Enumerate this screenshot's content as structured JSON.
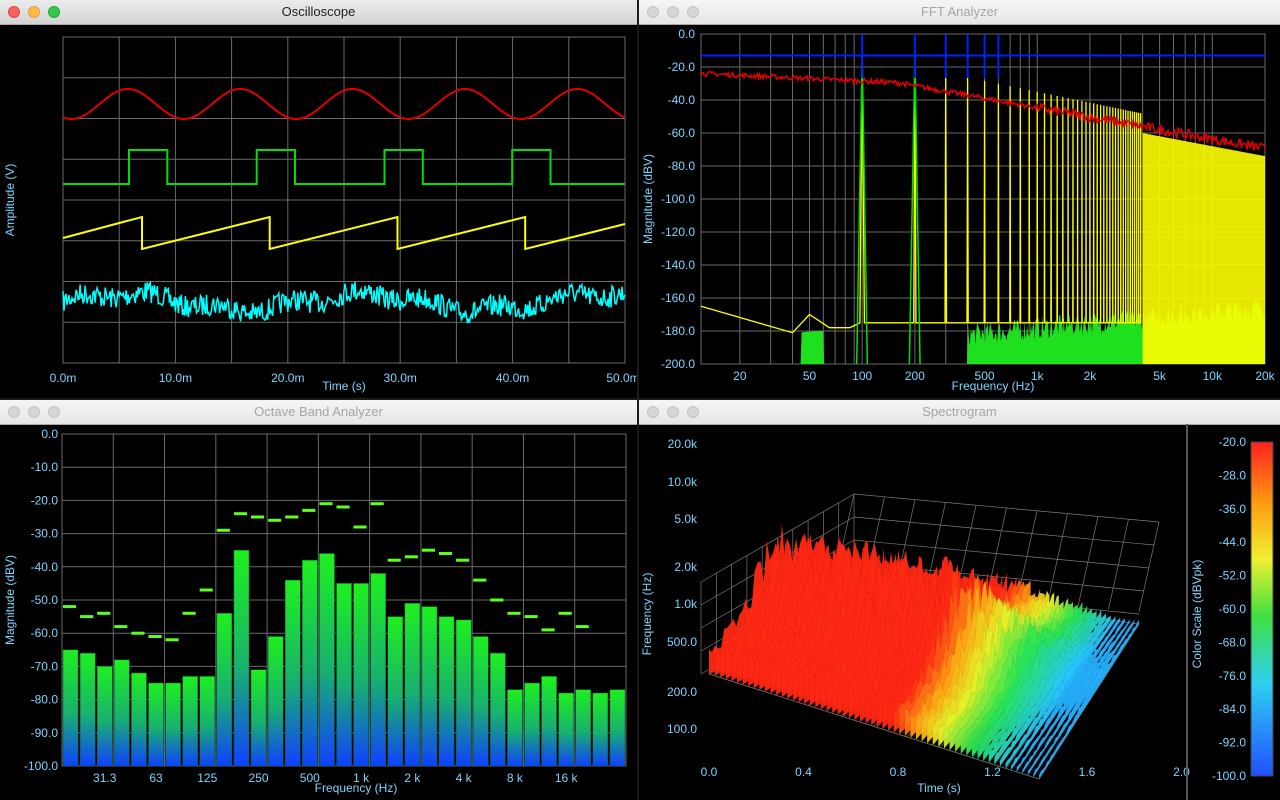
{
  "windows": {
    "oscilloscope": {
      "title": "Oscilloscope"
    },
    "fft": {
      "title": "FFT Analyzer"
    },
    "octave": {
      "title": "Octave Band Analyzer"
    },
    "spectrogram": {
      "title": "Spectrogram"
    }
  },
  "colors": {
    "sine": "#e00000",
    "square": "#00e000",
    "saw": "#ffff00",
    "noise": "#00ffff",
    "axis_text": "#7fd4ff",
    "grid": "#6a6a6a",
    "max_line": "#0020ff"
  },
  "chart_data": [
    {
      "type": "line",
      "xlabel": "Time (s)",
      "ylabel": "Amplitude (V)",
      "x_ticks": [
        "0.0m",
        "10.0m",
        "20.0m",
        "30.0m",
        "40.0m",
        "50.0m"
      ],
      "xlim": [
        0,
        50
      ],
      "series": [
        {
          "kind": "sine",
          "periods": 5
        },
        {
          "kind": "square",
          "periods": 4.4
        },
        {
          "kind": "sawtooth",
          "periods": 4.4
        },
        {
          "kind": "noise"
        }
      ],
      "grid": true
    },
    {
      "type": "line",
      "xlabel": "Frequency (Hz)",
      "ylabel": "Magnitude (dBV)",
      "y_ticks": [
        "0.0",
        "-20.0",
        "-40.0",
        "-60.0",
        "-80.0",
        "-100.0",
        "-120.0",
        "-140.0",
        "-160.0",
        "-180.0",
        "-200.0"
      ],
      "x_ticks": [
        "20",
        "50",
        "100",
        "200",
        "500",
        "1k",
        "2k",
        "5k",
        "10k",
        "20k"
      ],
      "ylim": [
        -200,
        0
      ],
      "xlim": [
        12,
        20000
      ],
      "log_x": true,
      "peak_hold_level": -13,
      "harmonics_hz": [
        100,
        200,
        300,
        400,
        500,
        600
      ],
      "grid": true
    },
    {
      "type": "bar",
      "xlabel": "Frequency (Hz)",
      "ylabel": "Magnitude (dBV)",
      "x_ticks": [
        "31.3",
        "63",
        "125",
        "250",
        "500",
        "1 k",
        "2 k",
        "4 k",
        "8 k",
        "16 k"
      ],
      "y_ticks": [
        "0.0",
        "-10.0",
        "-20.0",
        "-30.0",
        "-40.0",
        "-50.0",
        "-60.0",
        "-70.0",
        "-80.0",
        "-90.0",
        "-100.0"
      ],
      "ylim": [
        -100,
        0
      ],
      "values": [
        -65,
        -66,
        -70,
        -68,
        -72,
        -75,
        -75,
        -73,
        -73,
        -54,
        -35,
        -71,
        -61,
        -44,
        -38,
        -36,
        -45,
        -45,
        -42,
        -55,
        -51,
        -52,
        -55,
        -56,
        -61,
        -66,
        -77,
        -75,
        -73,
        -78,
        -77,
        -78,
        -77
      ],
      "peaks": [
        -52,
        -55,
        -54,
        -58,
        -60,
        -61,
        -62,
        -54,
        -47,
        -29,
        -24,
        -25,
        -26,
        -25,
        -23,
        -21,
        -22,
        -28,
        -21,
        -38,
        -37,
        -35,
        -36,
        -38,
        -44,
        -50,
        -54,
        -55,
        -59,
        -54,
        -58
      ],
      "grid": true
    },
    {
      "type": "heatmap",
      "xlabel": "Time (s)",
      "ylabel": "Frequency (Hz)",
      "x_ticks": [
        "0.0",
        "0.4",
        "0.8",
        "1.2",
        "1.6",
        "2.0"
      ],
      "y_ticks": [
        "20.0k",
        "10.0k",
        "5.0k",
        "2.0k",
        "1.0k",
        "500.0",
        "200.0",
        "100.0"
      ],
      "colorbar_label": "Color Scale (dBVpk)",
      "colorbar_ticks": [
        "-20.0",
        "-28.0",
        "-36.0",
        "-44.0",
        "-52.0",
        "-60.0",
        "-68.0",
        "-76.0",
        "-84.0",
        "-92.0",
        "-100.0"
      ],
      "zlim": [
        -100,
        -20
      ]
    }
  ]
}
